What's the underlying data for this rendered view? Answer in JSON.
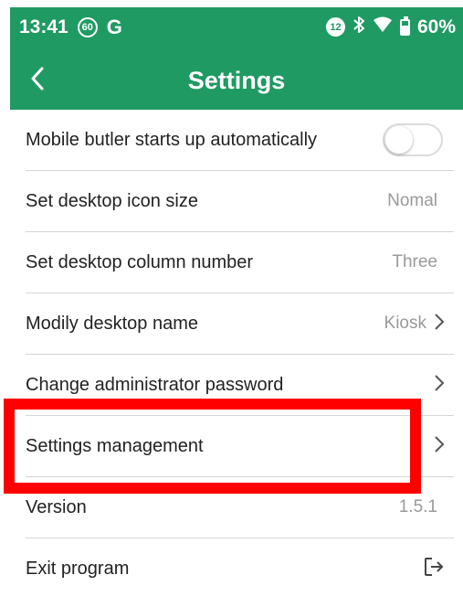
{
  "header_text_above": "",
  "status_bar": {
    "time": "13:41",
    "badge": "60",
    "g_letter": "G",
    "notif_badge": "12",
    "battery": "60%",
    "battery_level": 0.6
  },
  "title_bar": {
    "title": "Settings",
    "back_icon": "chevron-left-icon"
  },
  "settings": {
    "items": [
      {
        "label": "Mobile butler starts up automatically",
        "control": "toggle",
        "toggle_on": false
      },
      {
        "label": "Set desktop icon size",
        "value": "Nomal"
      },
      {
        "label": "Set desktop column number",
        "value": "Three"
      },
      {
        "label": "Modily desktop name",
        "value": "Kiosk",
        "chevron": true
      },
      {
        "label": "Change administrator password",
        "chevron": true
      },
      {
        "label": "Settings management",
        "chevron": true
      },
      {
        "label": "Version",
        "value": "1.5.1"
      },
      {
        "label": "Exit program",
        "icon": "exit-icon"
      }
    ]
  },
  "colors": {
    "header": "#1f9a63",
    "highlight": "#ff0000",
    "divider": "#d6d6d6",
    "value_text": "#9a9a9a"
  }
}
